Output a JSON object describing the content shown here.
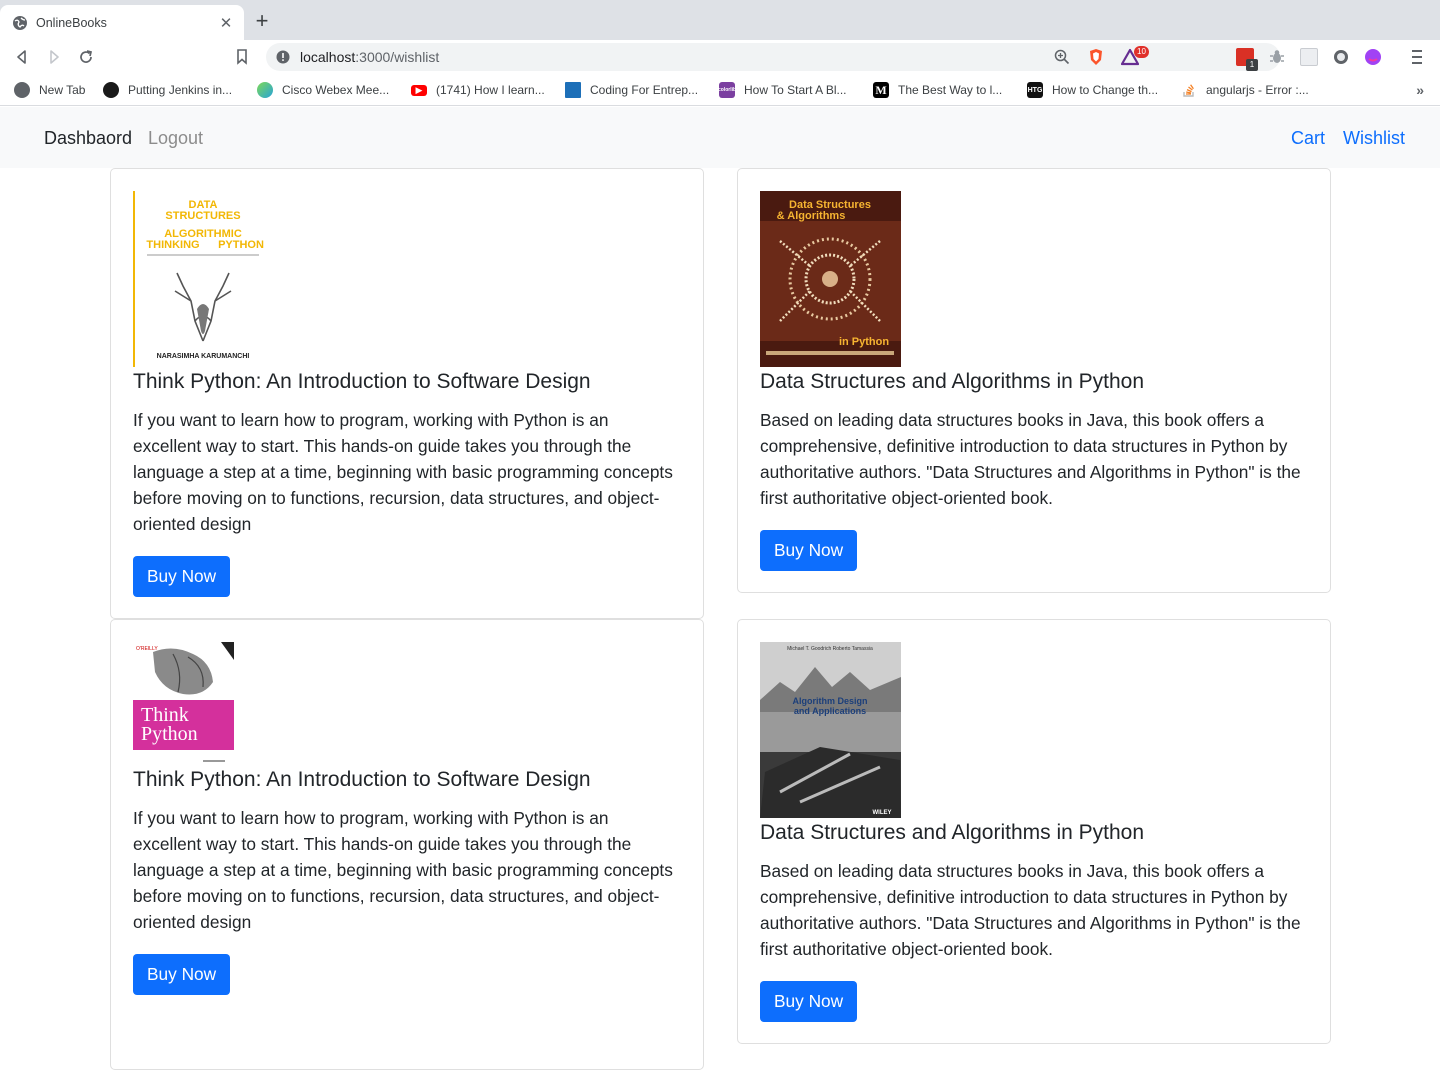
{
  "browser": {
    "tab_title": "OnlineBooks",
    "url_host": "localhost",
    "url_path": ":3000/wishlist",
    "brave_badge": "10",
    "ext_badge": "1",
    "bookmarks": [
      {
        "label": "New Tab",
        "icon": "globe-icon",
        "color": "#5f6368"
      },
      {
        "label": "Putting Jenkins in...",
        "icon": "jenkins-icon",
        "color": "#1a1a1a"
      },
      {
        "label": "Cisco Webex Mee...",
        "icon": "webex-icon",
        "color": "#27a3d8"
      },
      {
        "label": "(1741) How I learn...",
        "icon": "youtube-icon",
        "color": "#ff0000"
      },
      {
        "label": "Coding For Entrep...",
        "icon": "bookmark-icon",
        "color": "#1d6fb8"
      },
      {
        "label": "How To Start A Bl...",
        "icon": "colorlib-icon",
        "color": "#7b3fa0"
      },
      {
        "label": "The Best Way to l...",
        "icon": "medium-icon",
        "color": "#000000"
      },
      {
        "label": "How to Change th...",
        "icon": "htg-icon",
        "color": "#111111"
      },
      {
        "label": "angularjs - Error :...",
        "icon": "stackoverflow-icon",
        "color": "#f48024"
      }
    ]
  },
  "nav": {
    "brand": "Dashbaord",
    "logout": "Logout",
    "cart": "Cart",
    "wishlist": "Wishlist"
  },
  "books": [
    {
      "title": "Think Python: An Introduction to Software Design",
      "description": "If you want to learn how to program, working with Python is an excellent way to start. This hands-on guide takes you through the language a step at a time, beginning with basic programming concepts before moving on to functions, recursion, data structures, and object-oriented design",
      "button": "Buy Now",
      "cover": {
        "line1": "DATA",
        "line2": "STRUCTURES",
        "line3": "ALGORITHMIC",
        "line4": "THINKING",
        "line5": "PYTHON",
        "author": "NARASIMHA KARUMANCHI"
      }
    },
    {
      "title": "Data Structures and Algorithms in Python",
      "description": "Based on leading data structures books in Java, this book offers a comprehensive, definitive introduction to data structures in Python by authoritative authors. \"Data Structures and Algorithms in Python\" is the first authoritative object-oriented book.",
      "button": "Buy Now",
      "cover": {
        "line1": "Data Structures",
        "line2": "& Algorithms",
        "line3": "in Python"
      }
    },
    {
      "title": "Think Python: An Introduction to Software Design",
      "description": "If you want to learn how to program, working with Python is an excellent way to start. This hands-on guide takes you through the language a step at a time, beginning with basic programming concepts before moving on to functions, recursion, data structures, and object-oriented design",
      "button": "Buy Now",
      "cover": {
        "line1": "Think",
        "line2": "Python",
        "publisher": "O'REILLY"
      }
    },
    {
      "title": "Data Structures and Algorithms in Python",
      "description": "Based on leading data structures books in Java, this book offers a comprehensive, definitive introduction to data structures in Python by authoritative authors. \"Data Structures and Algorithms in Python\" is the first authoritative object-oriented book.",
      "button": "Buy Now",
      "cover": {
        "line1": "Algorithm Design",
        "line2": "and Applications",
        "authors": "Michael T. Goodrich   Roberto Tamassia",
        "publisher": "WILEY"
      }
    }
  ]
}
